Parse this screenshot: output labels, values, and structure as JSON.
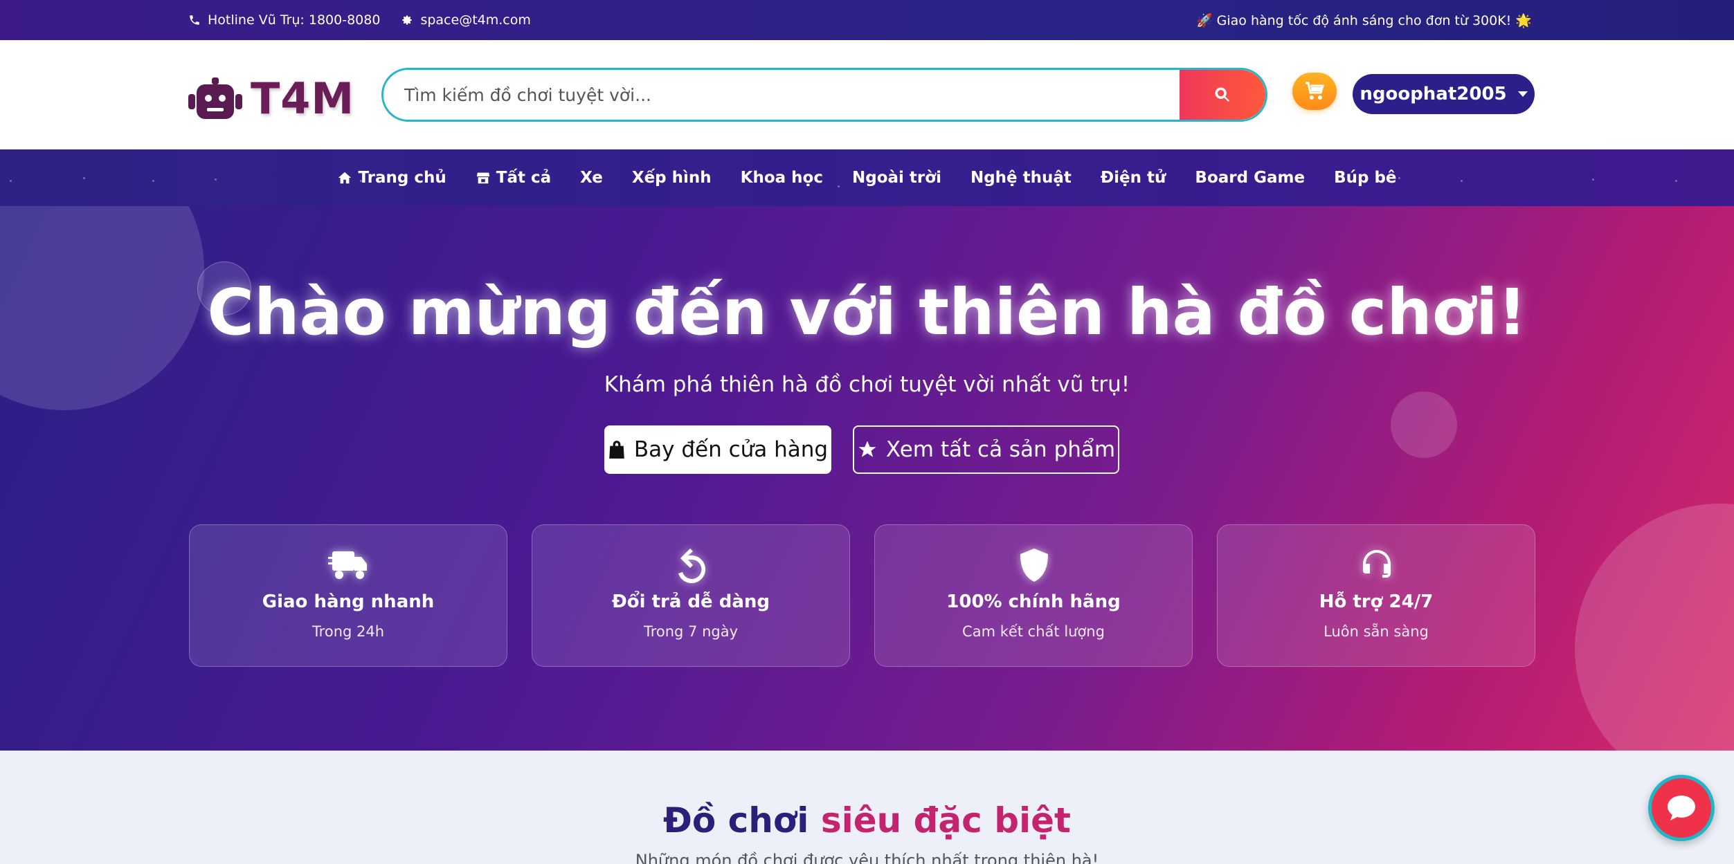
{
  "topbar": {
    "hotline": "Hotline Vũ Trụ: 1800-8080",
    "email": "space@t4m.com",
    "promo": "🚀 Giao hàng tốc độ ánh sáng cho đơn từ 300K! 🌟"
  },
  "header": {
    "logo_text": "T4M",
    "search_placeholder": "Tìm kiếm đồ chơi tuyệt vời...",
    "username": "ngoophat2005"
  },
  "nav": {
    "items": [
      "Trang chủ",
      "Tất cả",
      "Xe",
      "Xếp hình",
      "Khoa học",
      "Ngoài trời",
      "Nghệ thuật",
      "Điện tử",
      "Board Game",
      "Búp bê"
    ]
  },
  "hero": {
    "title": "Chào mừng đến với thiên hà đồ chơi!",
    "subtitle": "Khám phá thiên hà đồ chơi tuyệt vời nhất vũ trụ!",
    "primary_btn": "Bay đến cửa hàng",
    "secondary_btn": "Xem tất cả sản phẩm"
  },
  "features": [
    {
      "title": "Giao hàng nhanh",
      "sub": "Trong 24h",
      "icon": "truck-icon"
    },
    {
      "title": "Đổi trả dễ dàng",
      "sub": "Trong 7 ngày",
      "icon": "undo-icon"
    },
    {
      "title": "100% chính hãng",
      "sub": "Cam kết chất lượng",
      "icon": "shield-icon"
    },
    {
      "title": "Hỗ trợ 24/7",
      "sub": "Luôn sẵn sàng",
      "icon": "headset-icon"
    }
  ],
  "section": {
    "title_a": "Đồ chơi",
    "title_b": "siêu đặc biệt",
    "desc": "Những món đồ chơi được yêu thích nhất trong thiên hà!"
  },
  "colors": {
    "accent_cyan": "#22b8c9",
    "accent_red": "#f0365a",
    "brand_purple": "#2b1f8a",
    "logo_color": "#6b1d57"
  }
}
